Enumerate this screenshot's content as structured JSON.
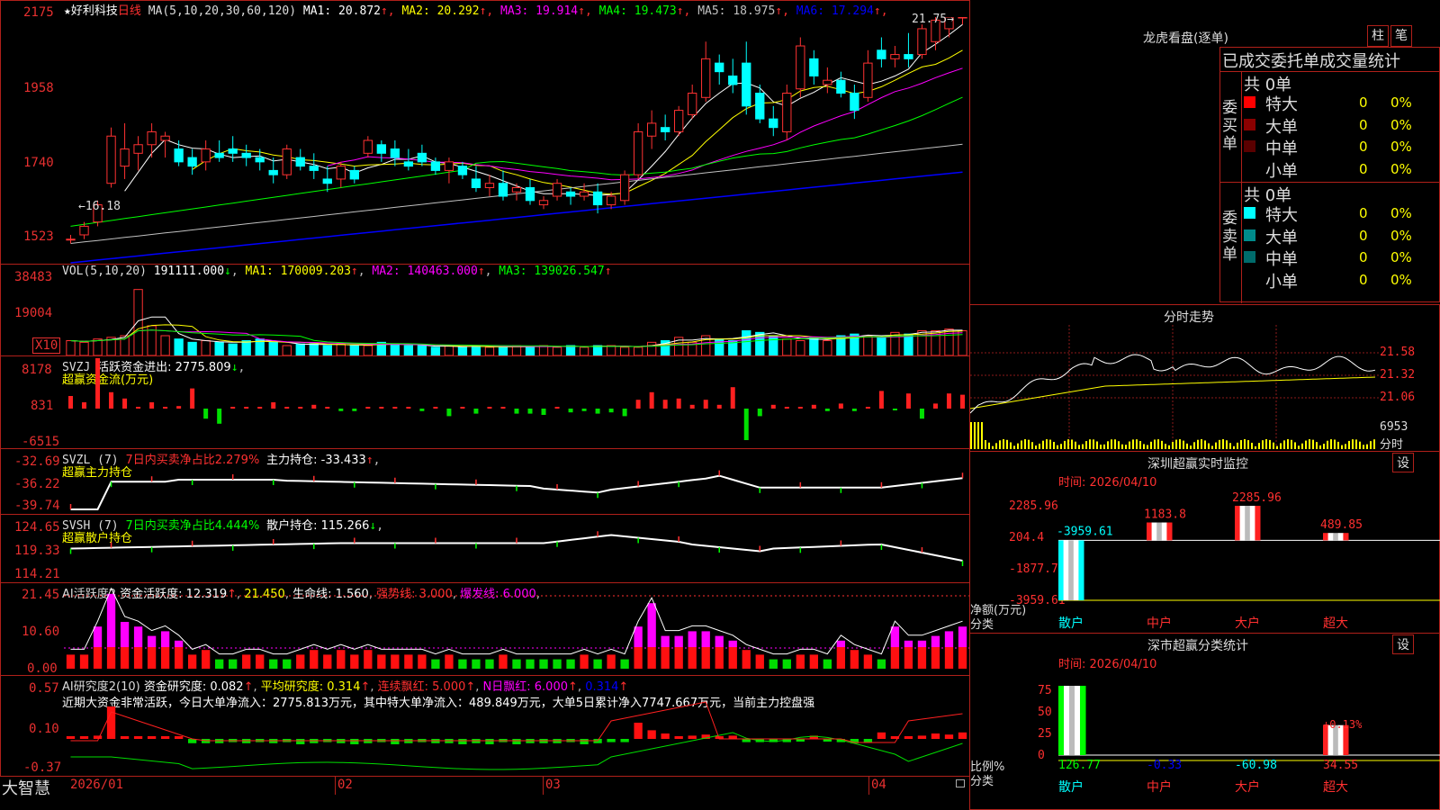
{
  "main": {
    "star": "★",
    "stock": "好利科技",
    "period": "日线",
    "ma_def": "MA(5,10,20,30,60,120)",
    "ma_items": [
      {
        "label": "MA1:",
        "value": "20.872",
        "arrow": "↑",
        "color": "#ffffff"
      },
      {
        "label": "MA2:",
        "value": "20.292",
        "arrow": "↑",
        "color": "#ffff00"
      },
      {
        "label": "MA3:",
        "value": "19.914",
        "arrow": "↑",
        "color": "#ff00ff"
      },
      {
        "label": "MA4:",
        "value": "19.473",
        "arrow": "↑",
        "color": "#00ff00"
      },
      {
        "label": "MA5:",
        "value": "18.975",
        "arrow": "↑",
        "color": "#c0c0c0"
      },
      {
        "label": "MA6:",
        "value": "17.294",
        "arrow": "↑",
        "color": "#0000ff"
      }
    ],
    "ticks": [
      "2175",
      "1958",
      "1740",
      "1523"
    ],
    "high_label": "21.75",
    "low_label": "16.18"
  },
  "vol": {
    "def": "VOL(5,10,20)",
    "value": "191111.000",
    "arrow": "↓",
    "ma1": "MA1: 170009.203",
    "ma2": "MA2: 140463.000",
    "ma3": "MA3: 139026.547",
    "arrow_up": "↑",
    "ticks": [
      "38483",
      "19004"
    ],
    "unit": "X10"
  },
  "svzj": {
    "name": "SVZJ",
    "text": "活跃资金进出: 2775.809",
    "arrow": "↓",
    "sub": "超赢资金流(万元)",
    "ticks": [
      "8178",
      "831",
      "-6515"
    ]
  },
  "svzl": {
    "name": "SVZL (7)",
    "pct": "7日内买卖净占比2.279%",
    "hold": "主力持仓: -33.433",
    "arrow": "↑",
    "sub": "超赢主力持仓",
    "ticks": [
      "-32.69",
      "-36.22",
      "-39.74"
    ]
  },
  "svsh": {
    "name": "SVSH (7)",
    "pct": "7日内买卖净占比4.444%",
    "hold": "散户持仓: 115.266",
    "arrow": "↓",
    "sub": "超赢散户持仓",
    "ticks": [
      "124.65",
      "119.33",
      "114.21"
    ]
  },
  "ai1": {
    "name": "AI活跃度2",
    "l1": "资金活跃度: 12.319",
    "a1": "↑",
    "l2": "21.450",
    "l3": "生命线: 1.560",
    "l4": "强势线: 3.000",
    "l5": "爆发线: 6.000",
    "ticks": [
      "21.45",
      "10.60",
      "0.00"
    ]
  },
  "ai2": {
    "name": "AI研究度2(10)",
    "l1": "资金研究度: 0.082",
    "l2": "平均研究度: 0.314",
    "l3": "连续飘红: 5.000",
    "l4": "N日飘红: 6.000",
    "l5": "0.314",
    "arrow": "↑",
    "summary": "近期大资金非常活跃，今日大单净流入：2775.813万元，其中特大单净流入：489.849万元，大单5日累计净入7747.667万元，当前主力控盘强",
    "ticks": [
      "0.57",
      "0.10",
      "-0.37"
    ]
  },
  "bottom": {
    "logo": "大智慧",
    "dates": [
      "2026/01",
      "02",
      "03",
      "04"
    ]
  },
  "right": {
    "title": "龙虎看盘(逐单)",
    "tab1": "柱",
    "tab2": "笔",
    "table_title": "已成交委托单成交量统计",
    "buy_label": "委买单",
    "sell_label": "委卖单",
    "buy_total": "共 0单",
    "sell_total": "共 0单",
    "buy_rows": [
      {
        "name": "特大",
        "qty": "0",
        "pct": "0%",
        "color": "#ff0000"
      },
      {
        "name": "大单",
        "qty": "0",
        "pct": "0%",
        "color": "#8b0000"
      },
      {
        "name": "中单",
        "qty": "0",
        "pct": "0%",
        "color": "#5a0000"
      },
      {
        "name": "小单",
        "qty": "0",
        "pct": "0%",
        "color": ""
      }
    ],
    "sell_rows": [
      {
        "name": "特大",
        "qty": "0",
        "pct": "0%",
        "color": "#00ffff"
      },
      {
        "name": "大单",
        "qty": "0",
        "pct": "0%",
        "color": "#008b8b"
      },
      {
        "name": "中单",
        "qty": "0",
        "pct": "0%",
        "color": "#006b6b"
      },
      {
        "name": "小单",
        "qty": "0",
        "pct": "0%",
        "color": ""
      }
    ],
    "intraday": {
      "title": "分时走势",
      "ticks": [
        "21.58",
        "21.32",
        "21.06"
      ],
      "vol": "6953",
      "vol_label": "分时"
    },
    "monitor": {
      "title": "深圳超赢实时监控",
      "btn": "设",
      "time": "时间: 2026/04/10",
      "ticks": [
        "2285.96",
        "204.4",
        "-1877.76",
        "-3959.61"
      ],
      "bars": [
        {
          "cat": "散户",
          "value": -3959.61,
          "label": "-3959.61"
        },
        {
          "cat": "中户",
          "value": 1183.8,
          "label": "1183.8"
        },
        {
          "cat": "大户",
          "value": 2285.96,
          "label": "2285.96"
        },
        {
          "cat": "超大",
          "value": 489.85,
          "label": "489.85"
        }
      ],
      "axis_label": "净额(万元)",
      "cat_label": "分类"
    },
    "stats": {
      "title": "深市超赢分类统计",
      "btn": "设",
      "time": "时间: 2026/04/10",
      "ticks": [
        "75",
        "50",
        "25",
        "0"
      ],
      "bars": [
        {
          "cat": "散户",
          "value": 126.77,
          "label": "126.77"
        },
        {
          "cat": "中户",
          "value": -0.33,
          "label": "-0.33"
        },
        {
          "cat": "大户",
          "value": -60.98,
          "label": "-60.98"
        },
        {
          "cat": "超大",
          "value": 34.55,
          "label": "34.55"
        }
      ],
      "top_label": "+0.13%",
      "axis_label": "比例%",
      "cat_label": "分类"
    }
  },
  "chart_data": [
    {
      "type": "candlestick",
      "title": "好利科技 日线",
      "ylim": [
        15.0,
        22.0
      ],
      "candles": [
        [
          16.2,
          16.3,
          16.1,
          16.2
        ],
        [
          16.3,
          16.6,
          16.2,
          16.5
        ],
        [
          16.6,
          17.1,
          16.5,
          17.0
        ],
        [
          17.5,
          18.8,
          17.4,
          18.6
        ],
        [
          17.9,
          18.9,
          17.6,
          18.3
        ],
        [
          18.2,
          18.6,
          17.8,
          18.4
        ],
        [
          18.4,
          18.9,
          18.1,
          18.7
        ],
        [
          18.5,
          18.7,
          18.1,
          18.6
        ],
        [
          18.3,
          18.5,
          17.9,
          18.0
        ],
        [
          18.1,
          18.3,
          17.7,
          17.9
        ],
        [
          18.0,
          18.5,
          17.8,
          18.3
        ],
        [
          18.2,
          18.5,
          18.0,
          18.1
        ],
        [
          18.3,
          18.6,
          18.0,
          18.2
        ],
        [
          18.2,
          18.4,
          17.9,
          18.1
        ],
        [
          18.1,
          18.3,
          17.8,
          18.0
        ],
        [
          17.8,
          18.1,
          17.5,
          17.7
        ],
        [
          17.7,
          18.4,
          17.6,
          18.3
        ],
        [
          18.1,
          18.3,
          17.8,
          17.9
        ],
        [
          17.9,
          18.2,
          17.6,
          17.8
        ],
        [
          17.6,
          17.9,
          17.3,
          17.5
        ],
        [
          17.6,
          18.0,
          17.4,
          17.9
        ],
        [
          17.8,
          17.9,
          17.5,
          17.6
        ],
        [
          18.2,
          18.6,
          18.1,
          18.5
        ],
        [
          18.4,
          18.5,
          18.0,
          18.2
        ],
        [
          18.3,
          18.5,
          17.9,
          18.1
        ],
        [
          18.0,
          18.3,
          17.8,
          17.9
        ],
        [
          18.2,
          18.4,
          17.9,
          18.0
        ],
        [
          18.0,
          18.1,
          17.7,
          17.8
        ],
        [
          17.8,
          18.1,
          17.5,
          18.0
        ],
        [
          17.9,
          18.0,
          17.6,
          17.7
        ],
        [
          17.6,
          17.9,
          17.3,
          17.4
        ],
        [
          17.4,
          17.7,
          17.2,
          17.5
        ],
        [
          17.5,
          17.8,
          17.1,
          17.2
        ],
        [
          17.3,
          17.5,
          17.1,
          17.4
        ],
        [
          17.4,
          17.6,
          17.0,
          17.1
        ],
        [
          17.0,
          17.2,
          16.9,
          17.1
        ],
        [
          17.2,
          17.6,
          17.1,
          17.5
        ],
        [
          17.3,
          17.4,
          17.0,
          17.2
        ],
        [
          17.2,
          17.5,
          17.1,
          17.3
        ],
        [
          17.3,
          17.5,
          16.8,
          17.0
        ],
        [
          17.0,
          17.3,
          16.9,
          17.2
        ],
        [
          17.1,
          17.8,
          17.0,
          17.7
        ],
        [
          17.7,
          18.9,
          17.6,
          18.7
        ],
        [
          18.6,
          19.2,
          18.3,
          18.9
        ],
        [
          18.8,
          19.1,
          18.5,
          18.7
        ],
        [
          18.7,
          19.3,
          18.6,
          19.2
        ],
        [
          19.1,
          19.8,
          19.0,
          19.6
        ],
        [
          19.5,
          20.8,
          19.4,
          20.4
        ],
        [
          20.3,
          20.5,
          19.8,
          20.1
        ],
        [
          20.0,
          20.4,
          19.6,
          19.8
        ],
        [
          20.3,
          20.8,
          19.1,
          19.3
        ],
        [
          19.6,
          19.8,
          18.9,
          19.0
        ],
        [
          19.0,
          19.3,
          18.6,
          18.8
        ],
        [
          18.7,
          19.8,
          18.5,
          19.6
        ],
        [
          19.7,
          20.9,
          19.5,
          20.7
        ],
        [
          20.4,
          20.6,
          19.8,
          20.0
        ],
        [
          19.8,
          20.2,
          19.6,
          19.9
        ],
        [
          19.9,
          20.1,
          19.5,
          19.6
        ],
        [
          19.6,
          19.8,
          19.0,
          19.2
        ],
        [
          19.5,
          20.6,
          19.4,
          20.3
        ],
        [
          20.6,
          20.9,
          20.2,
          20.4
        ],
        [
          20.4,
          20.7,
          20.2,
          20.5
        ],
        [
          20.5,
          21.0,
          20.2,
          20.4
        ],
        [
          20.5,
          21.2,
          20.4,
          21.1
        ],
        [
          20.8,
          21.4,
          20.6,
          21.3
        ],
        [
          21.1,
          21.6,
          20.9,
          21.5
        ],
        [
          21.4,
          21.8,
          21.2,
          21.7
        ]
      ]
    },
    {
      "type": "bar",
      "title": "VOL",
      "values": [
        9,
        8,
        10,
        11,
        12,
        40,
        18,
        12,
        10,
        8,
        9,
        8,
        7,
        9,
        10,
        8,
        6,
        7,
        7,
        6,
        7,
        6,
        6,
        8,
        7,
        6,
        6,
        5,
        6,
        5,
        6,
        5,
        5,
        6,
        5,
        6,
        5,
        6,
        5,
        6,
        6,
        5,
        5,
        8,
        9,
        11,
        8,
        12,
        10,
        9,
        15,
        14,
        12,
        10,
        9,
        11,
        9,
        12,
        13,
        12,
        11,
        14,
        13,
        15,
        15,
        16,
        15
      ]
    }
  ]
}
